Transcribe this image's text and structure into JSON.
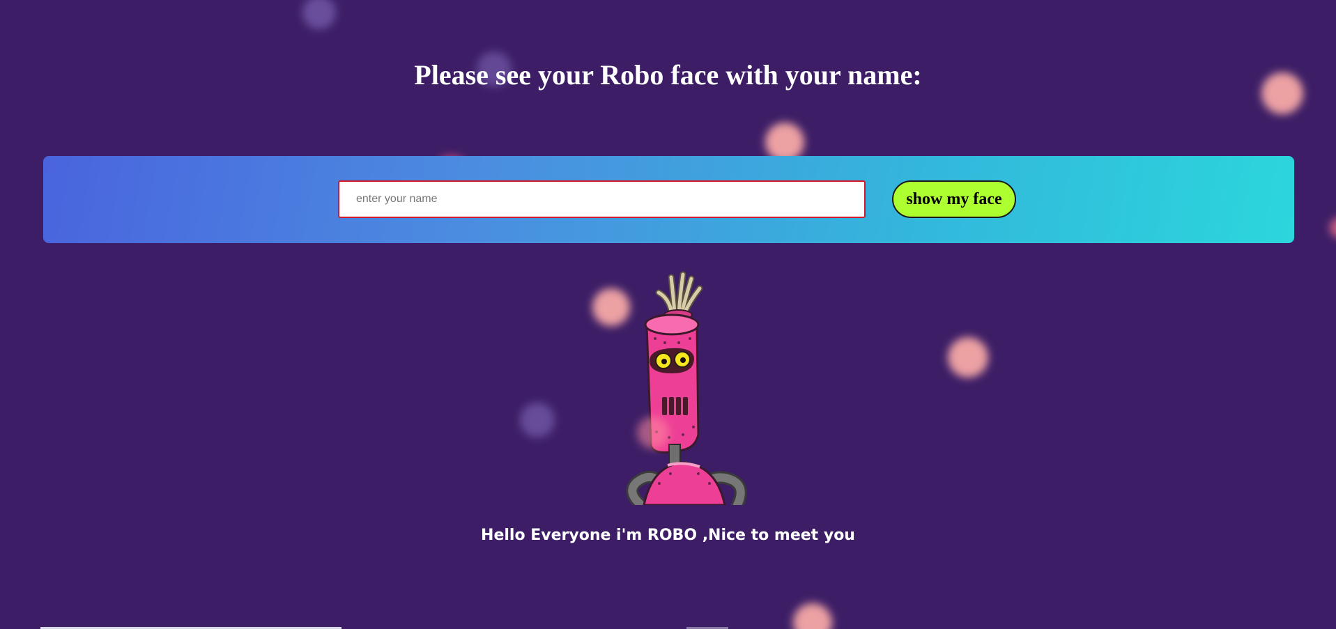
{
  "header": {
    "title": "Please see your Robo face with your name:"
  },
  "form": {
    "name_value": "",
    "name_placeholder": "enter your name",
    "submit_label": "show my face"
  },
  "robot": {
    "greeting": "Hello Everyone i'm ROBO ,Nice to meet you"
  },
  "colors": {
    "background": "#3d1e66",
    "band_start": "#4a64de",
    "band_end": "#2bd6dc",
    "button": "#adff2f",
    "input_border": "#d0182c",
    "robot_body": "#ee3f96",
    "particle_pink": "#ffb3b0",
    "particle_purple": "#6a4a9e"
  },
  "icons": {
    "robot": "robot-face-image",
    "particles": "bokeh-particle"
  }
}
